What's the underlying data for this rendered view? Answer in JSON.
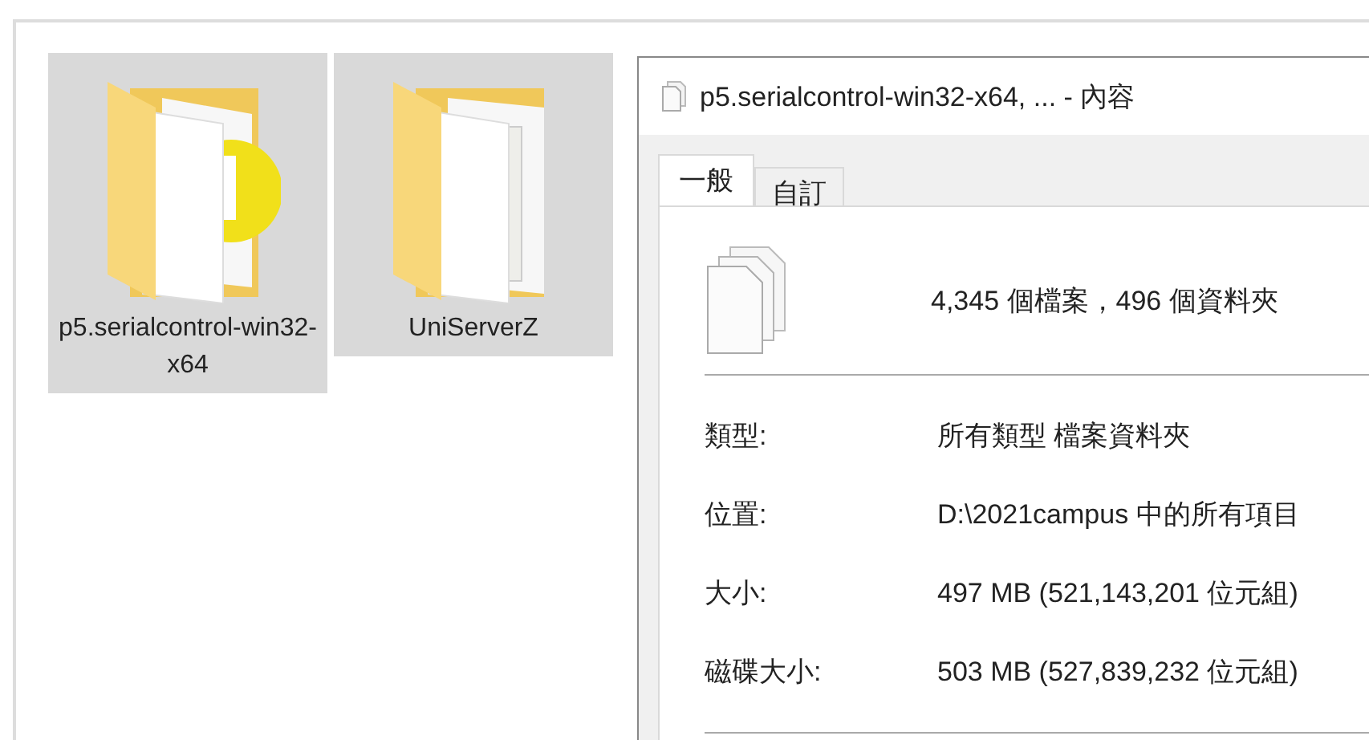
{
  "folders": [
    {
      "name": "p5.serialcontrol-win32-x64",
      "kind": "app",
      "selected": true
    },
    {
      "name": "UniServerZ",
      "kind": "docs",
      "selected": true
    }
  ],
  "dialog": {
    "title": "p5.serialcontrol-win32-x64, ... - 內容",
    "tabs": [
      {
        "label": "一般",
        "selected": true
      },
      {
        "label": "自訂",
        "selected": false
      }
    ],
    "summary": "4,345 個檔案，496 個資料夾",
    "properties": [
      {
        "label": "類型:",
        "value": "所有類型 檔案資料夾"
      },
      {
        "label": "位置:",
        "value": "D:\\2021campus 中的所有項目"
      },
      {
        "label": "大小:",
        "value": "497 MB (521,143,201 位元組)"
      },
      {
        "label": "磁碟大小:",
        "value": "503 MB (527,839,232 位元組)"
      }
    ]
  }
}
